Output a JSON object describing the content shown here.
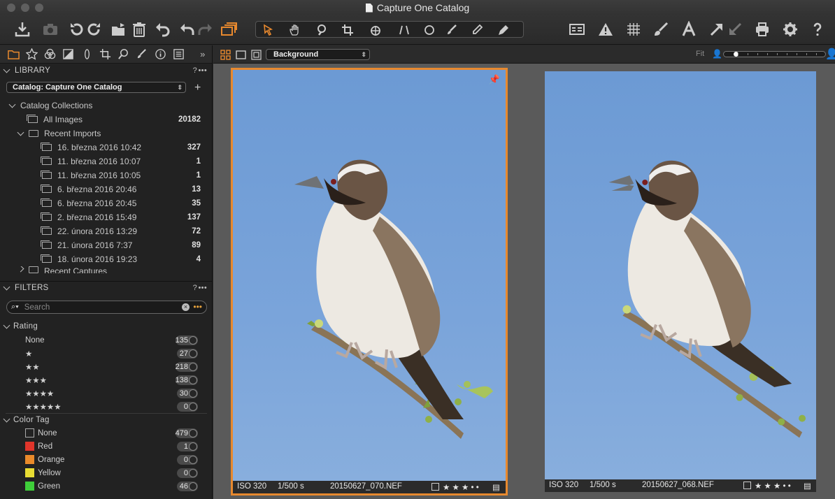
{
  "window": {
    "title": "Capture One Catalog"
  },
  "library": {
    "header": "LIBRARY",
    "help": "?",
    "more": "•••",
    "catalog_select": "Catalog: Capture One Catalog",
    "tree": [
      {
        "label": "Catalog Collections",
        "count": ""
      },
      {
        "label": "All Images",
        "count": "20182"
      },
      {
        "label": "Recent Imports",
        "count": ""
      },
      {
        "label": "16. března 2016 10:42",
        "count": "327"
      },
      {
        "label": "11. března 2016 10:07",
        "count": "1"
      },
      {
        "label": "11. března 2016 10:05",
        "count": "1"
      },
      {
        "label": "6. března 2016 20:46",
        "count": "13"
      },
      {
        "label": "6. března 2016 20:45",
        "count": "35"
      },
      {
        "label": "2. března 2016 15:49",
        "count": "137"
      },
      {
        "label": "22. února 2016 13:29",
        "count": "72"
      },
      {
        "label": "21. února 2016 7:37",
        "count": "89"
      },
      {
        "label": "18. února 2016 19:23",
        "count": "4"
      },
      {
        "label": "Recent Captures",
        "count": ""
      }
    ]
  },
  "filters": {
    "header": "FILTERS",
    "help": "?",
    "more": "•••",
    "search_placeholder": "Search",
    "rating_header": "Rating",
    "ratings": [
      {
        "label": "None",
        "count": "135"
      },
      {
        "label": "★",
        "count": "27"
      },
      {
        "label": "★★",
        "count": "218"
      },
      {
        "label": "★★★",
        "count": "138"
      },
      {
        "label": "★★★★",
        "count": "30"
      },
      {
        "label": "★★★★★",
        "count": "0"
      }
    ],
    "color_header": "Color Tag",
    "colors": [
      {
        "label": "None",
        "count": "479",
        "color": "#222222"
      },
      {
        "label": "Red",
        "count": "1",
        "color": "#e0352b"
      },
      {
        "label": "Orange",
        "count": "0",
        "color": "#e98a2a"
      },
      {
        "label": "Yellow",
        "count": "0",
        "color": "#e8dc33"
      },
      {
        "label": "Green",
        "count": "46",
        "color": "#3fcf3a"
      }
    ]
  },
  "viewer": {
    "background_select": "Background",
    "fit_label": "Fit",
    "zoom_fraction": 0.1,
    "images": [
      {
        "iso": "ISO 320",
        "shutter": "1/500 s",
        "filename": "20150627_070.NEF",
        "rating": "★ ★ ★ • •",
        "selected": true
      },
      {
        "iso": "ISO 320",
        "shutter": "1/500 s",
        "filename": "20150627_068.NEF",
        "rating": "★ ★ ★ • •",
        "selected": false
      }
    ]
  },
  "colors": {
    "accent": "#e8892e",
    "sky": "#7aa4da"
  }
}
